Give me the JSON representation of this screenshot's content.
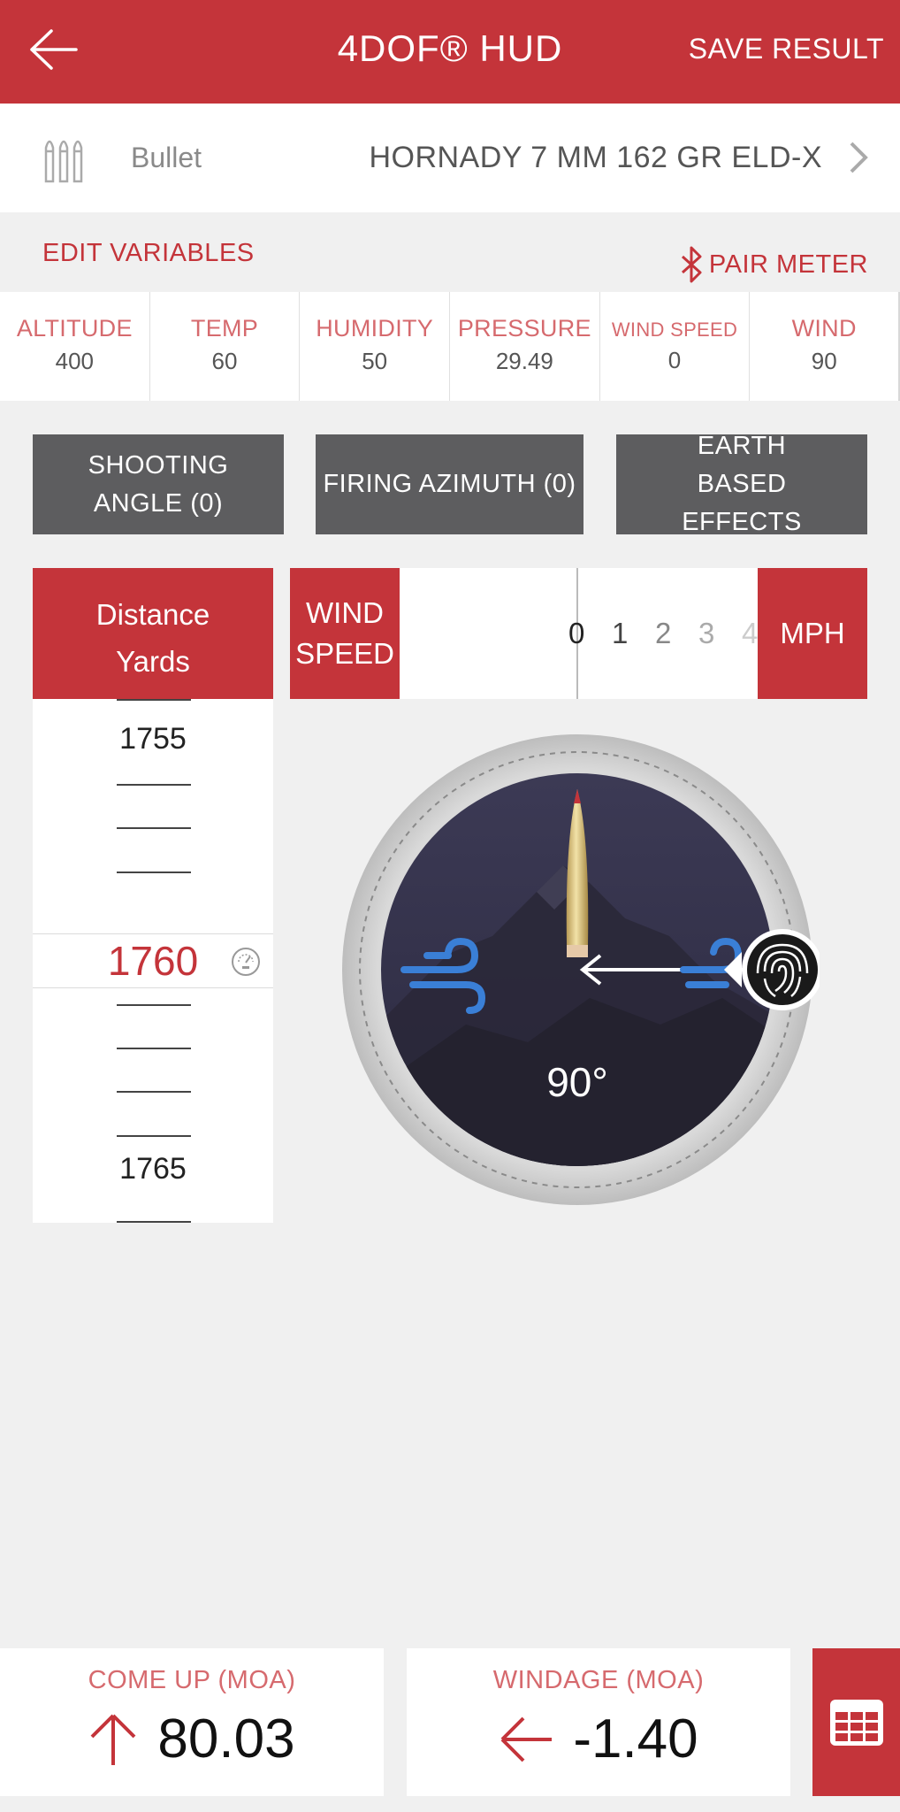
{
  "header": {
    "title": "4DOF® HUD",
    "save_label": "SAVE RESULT"
  },
  "bullet": {
    "label": "Bullet",
    "value": "HORNADY 7 MM 162 GR ELD-X"
  },
  "variables": {
    "edit_label": "EDIT VARIABLES",
    "pair_label": "PAIR METER",
    "items": [
      {
        "label": "ALTITUDE",
        "value": "400"
      },
      {
        "label": "TEMP",
        "value": "60"
      },
      {
        "label": "HUMIDITY",
        "value": "50"
      },
      {
        "label": "PRESSURE",
        "value": "29.49"
      },
      {
        "label": "WIND SPEED",
        "value": "0"
      },
      {
        "label": "WIND",
        "value": "90"
      }
    ]
  },
  "buttons": {
    "shooting_angle": "SHOOTING ANGLE (0)",
    "firing_azimuth": "FIRING AZIMUTH (0)",
    "earth_effects": "EARTH BASED EFFECTS"
  },
  "distance": {
    "header_line1": "Distance",
    "header_line2": "Yards",
    "above_value": "1755",
    "selected_value": "1760",
    "below_value": "1765"
  },
  "wind": {
    "header": "WIND SPEED",
    "unit": "MPH",
    "scale": [
      "0",
      "1",
      "2",
      "3",
      "4"
    ]
  },
  "compass": {
    "angle_label": "90°"
  },
  "results": {
    "come_up_label": "COME UP (MOA)",
    "come_up_value": "80.03",
    "windage_label": "WINDAGE (MOA)",
    "windage_value": "-1.40"
  },
  "colors": {
    "brand_red": "#c4343a",
    "button_gray": "#5d5d5f",
    "wind_blue": "#3a7fd6"
  }
}
